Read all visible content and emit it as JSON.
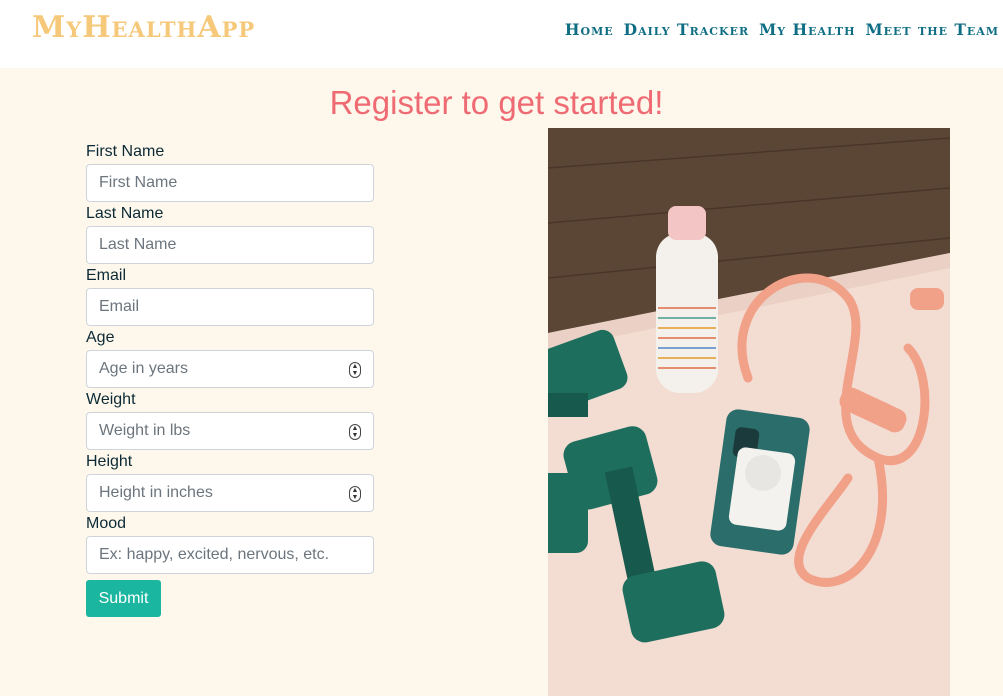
{
  "header": {
    "brand": "MyHealthApp",
    "nav": [
      "Home",
      "Daily Tracker",
      "My Health",
      "Meet the Team"
    ]
  },
  "page": {
    "title": "Register to get started!"
  },
  "form": {
    "fields": [
      {
        "label": "First Name",
        "placeholder": "First Name",
        "type": "text"
      },
      {
        "label": "Last Name",
        "placeholder": "Last Name",
        "type": "text"
      },
      {
        "label": "Email",
        "placeholder": "Email",
        "type": "text"
      },
      {
        "label": "Age",
        "placeholder": "Age in years",
        "type": "number"
      },
      {
        "label": "Weight",
        "placeholder": "Weight in lbs",
        "type": "number"
      },
      {
        "label": "Height",
        "placeholder": "Height in inches",
        "type": "number"
      },
      {
        "label": "Mood",
        "placeholder": "Ex: happy, excited, nervous, etc.",
        "type": "text"
      }
    ],
    "submit_label": "Submit"
  },
  "colors": {
    "brand": "#f6c87a",
    "nav": "#0f6e83",
    "title": "#ef6b73",
    "button": "#1ab6a0",
    "background": "#fef7ec"
  }
}
